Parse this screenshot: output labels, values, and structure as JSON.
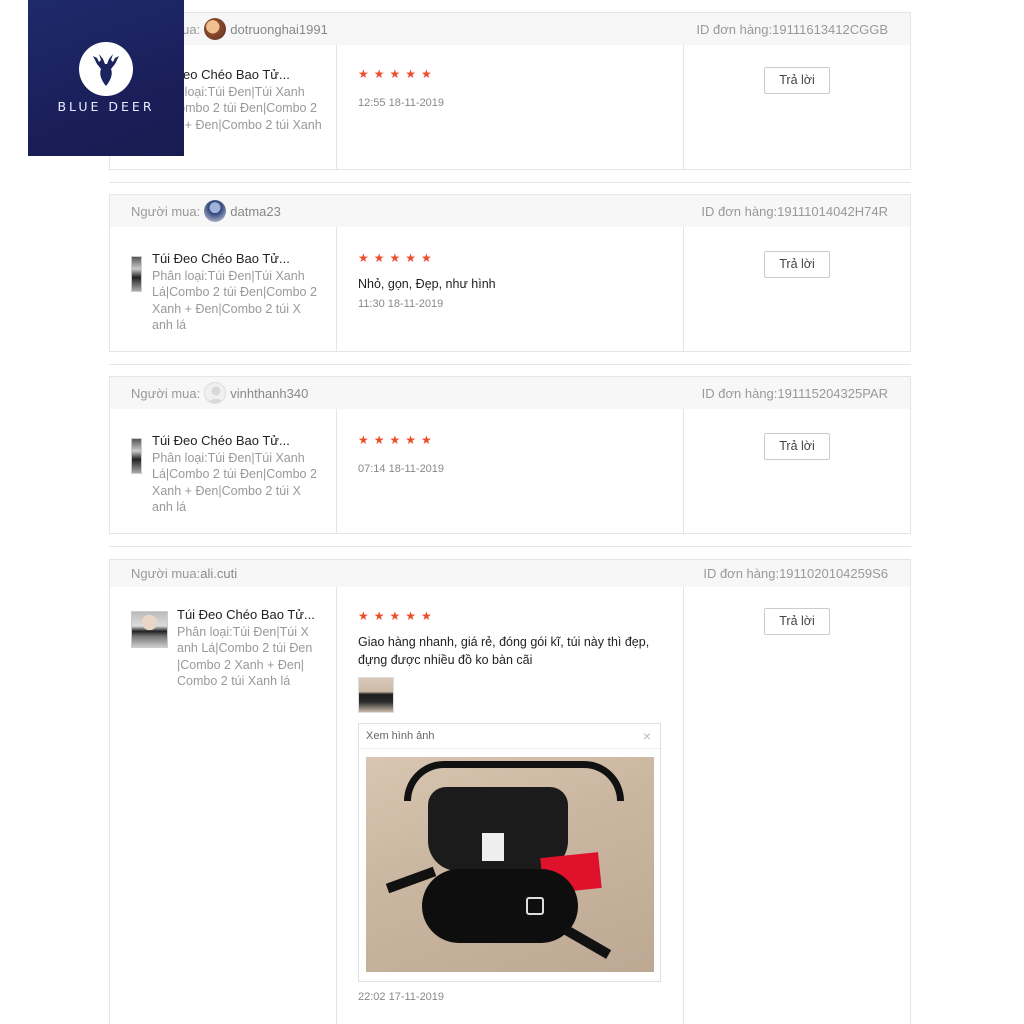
{
  "logo": {
    "text": "BLUE DEER"
  },
  "ui": {
    "reply_label": "Trả lời",
    "viewer_title": "Xem hình ảnh",
    "close_glyph": "×",
    "star_glyphs": "★★★★★"
  },
  "reviews": [
    {
      "buyer_label": "Người mua:",
      "buyer_name": "dotruonghai1991",
      "order_id": "ID đơn hàng:19111613412CGGB",
      "product_name": "Túi Đeo Chéo Bao Tử...",
      "product_variant": "Phân loại:Túi Đen|Túi Xanh Lá|Combo 2 túi Đen|Combo 2 Xanh + Đen|Combo 2 túi Xanh lá",
      "rating": 5,
      "comment": "",
      "time": "12:55 18-11-2019"
    },
    {
      "buyer_label": "Người mua:",
      "buyer_name": "datma23",
      "order_id": "ID đơn hàng:19111014042H74R",
      "product_name": "Túi Đeo Chéo Bao Tử...",
      "product_variant": "Phân loại:Túi Đen|Túi Xanh Lá|Combo 2 túi Đen|Combo 2 Xanh + Đen|Combo 2 túi X anh lá",
      "rating": 5,
      "comment": "Nhỏ, gọn, Đẹp, như hình",
      "time": "11:30 18-11-2019"
    },
    {
      "buyer_label": "Người mua:",
      "buyer_name": "vinhthanh340",
      "order_id": "ID đơn hàng:191115204325PAR",
      "product_name": "Túi Đeo Chéo Bao Tử...",
      "product_variant": "Phân loại:Túi Đen|Túi Xanh Lá|Combo 2 túi Đen|Combo 2 Xanh + Đen|Combo 2 túi X anh lá",
      "rating": 5,
      "comment": "",
      "time": "07:14 18-11-2019"
    },
    {
      "buyer_label": "Người mua:",
      "buyer_name": "ali.cuti",
      "order_id": "ID đơn hàng:1911020104259S6",
      "product_name": "Túi Đeo Chéo Bao Tử...",
      "product_variant": "Phân loại:Túi Đen|Túi X anh Lá|Combo 2 túi Đen |Combo 2 Xanh + Đen| Combo 2 túi Xanh lá",
      "rating": 5,
      "comment": "Giao hàng nhanh, giá rẻ, đóng gói kĩ, túi này thì đẹp, đựng được nhiều đồ ko bàn cãi",
      "time": "22:02 17-11-2019"
    }
  ]
}
